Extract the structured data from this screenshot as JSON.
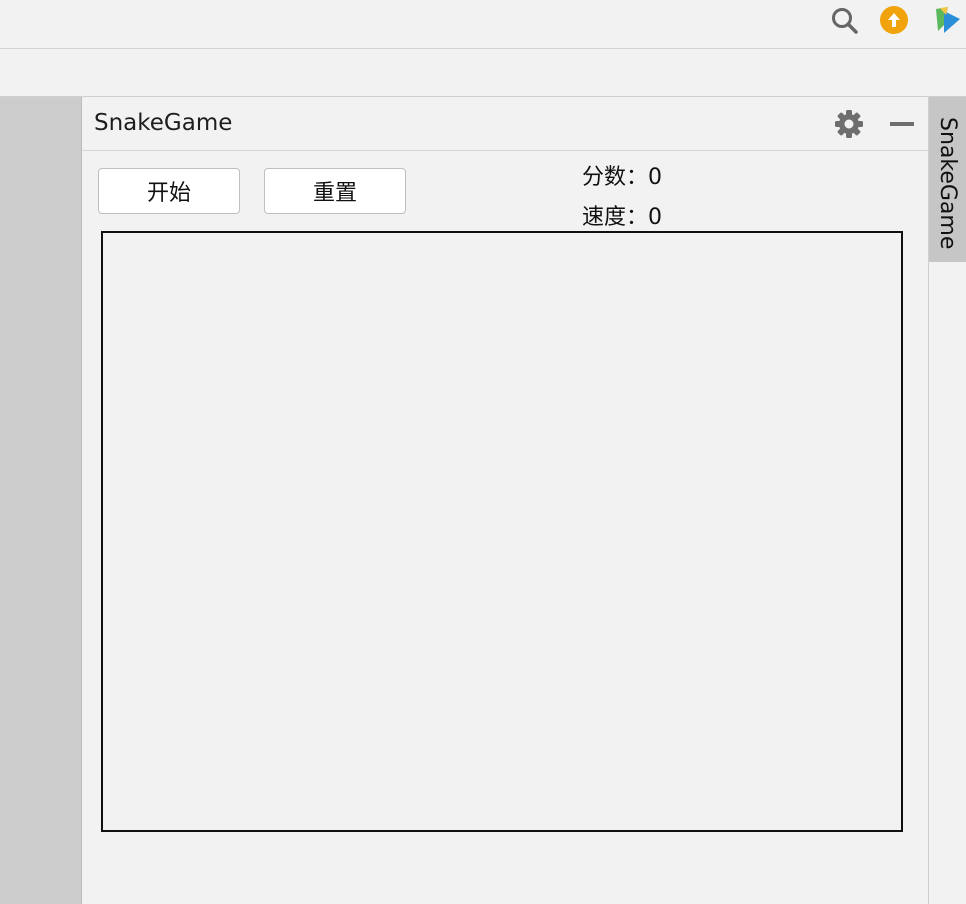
{
  "toolbar": {
    "icons": [
      "search-icon",
      "update-icon",
      "plugin-logo-icon"
    ],
    "update_color": "#f0a30a"
  },
  "panel": {
    "title": "SnakeGame",
    "icons": [
      "gear-icon",
      "minimize-icon"
    ]
  },
  "controls": {
    "start_label": "开始",
    "reset_label": "重置"
  },
  "stats": {
    "score_label": "分数：",
    "score_value": "0",
    "speed_label": "速度：",
    "speed_value": "0"
  },
  "side_tab": {
    "label": "SnakeGame"
  }
}
